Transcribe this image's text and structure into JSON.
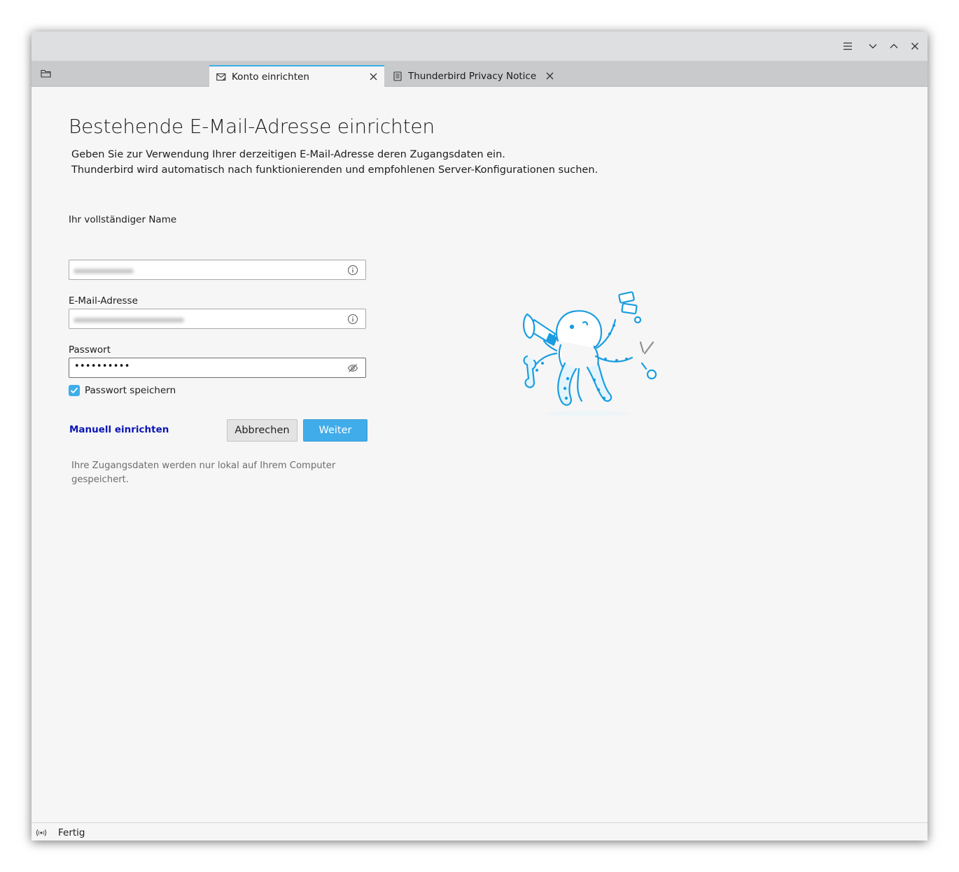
{
  "window": {
    "controls": [
      "hamburger-menu-icon",
      "minimize-icon",
      "maximize-icon",
      "close-icon"
    ]
  },
  "tabs": [
    {
      "label": "Konto einrichten",
      "icon": "mail-setup-icon",
      "active": true
    },
    {
      "label": "Thunderbird Privacy Notice —",
      "icon": "document-icon",
      "active": false
    }
  ],
  "page": {
    "title": "Bestehende E-Mail-Adresse einrichten",
    "description_line1": "Geben Sie zur Verwendung Ihrer derzeitigen E-Mail-Adresse deren Zugangsdaten ein.",
    "description_line2": "Thunderbird wird automatisch nach funktionierenden und empfohlenen Server-Konfigurationen suchen."
  },
  "form": {
    "name_label": "Ihr vollständiger Name",
    "email_label": "E-Mail-Adresse",
    "password_label": "Passwort",
    "password_value": "••••••••••",
    "remember_password_label": "Passwort speichern",
    "remember_password_checked": true
  },
  "actions": {
    "manual_link": "Manuell einrichten",
    "cancel_label": "Abbrechen",
    "next_label": "Weiter"
  },
  "privacy_note": "Ihre Zugangsdaten werden nur lokal auf Ihrem Computer gespeichert.",
  "status": {
    "text": "Fertig"
  },
  "colors": {
    "accent": "#3daee9",
    "link": "#0b16b4",
    "illustration": "#1a9de0"
  }
}
